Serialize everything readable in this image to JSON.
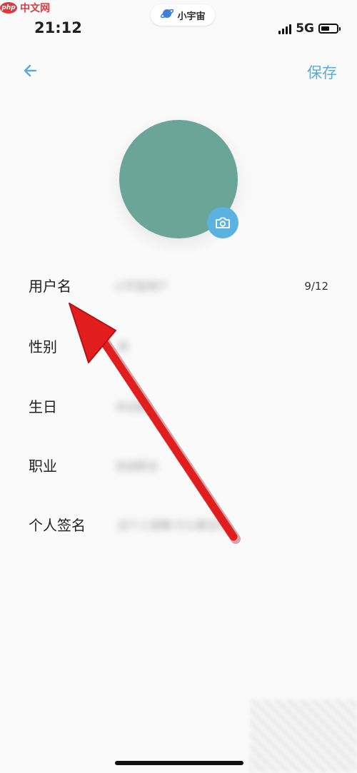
{
  "watermark": {
    "logo": "php",
    "text": "中文网"
  },
  "status_bar": {
    "time": "21:12",
    "network": "5G",
    "app_pill": "小宇宙",
    "battery_level": 0.55
  },
  "nav": {
    "save_label": "保存"
  },
  "fields": [
    {
      "label": "用户名",
      "value": "小宇宙用户",
      "count": "9/12"
    },
    {
      "label": "性别",
      "value": "男"
    },
    {
      "label": "生日",
      "value": "未设置"
    },
    {
      "label": "职业",
      "value": "自由职业"
    },
    {
      "label": "个人签名",
      "value": "这个人很懒 什么都没写"
    }
  ],
  "colors": {
    "accent": "#5fa9d6",
    "avatar": "#6aa597",
    "camera_badge": "#5bb2e0",
    "annotation_arrow": "#e11d1d"
  },
  "icons": {
    "back": "arrow-left-icon",
    "camera": "camera-icon",
    "planet": "planet-icon"
  }
}
